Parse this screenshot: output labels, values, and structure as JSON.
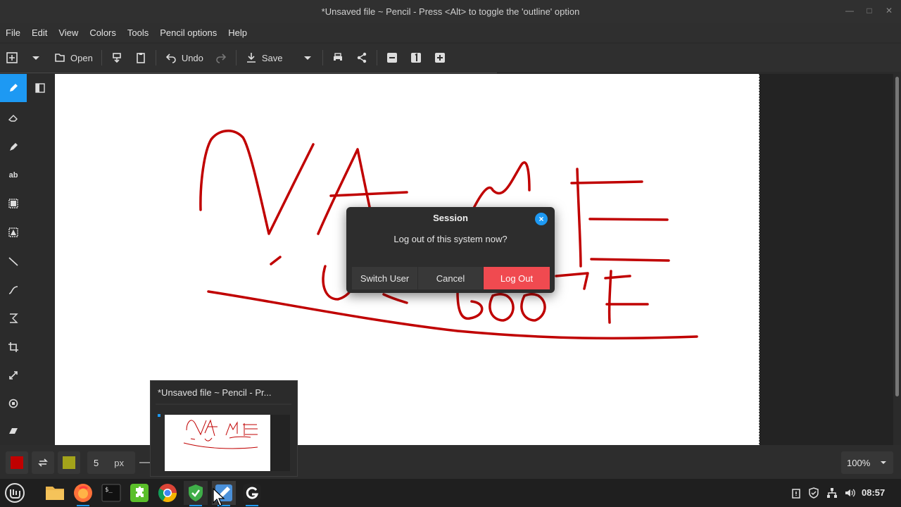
{
  "window": {
    "title": "*Unsaved file ~ Pencil - Press <Alt> to toggle the 'outline' option"
  },
  "menu": [
    "File",
    "Edit",
    "View",
    "Colors",
    "Tools",
    "Pencil options",
    "Help"
  ],
  "toolbar": {
    "open": "Open",
    "undo": "Undo",
    "save": "Save"
  },
  "options": {
    "size_value": "5",
    "size_unit": "px",
    "zoom": "100%"
  },
  "colors": {
    "main": "#c00000",
    "secondary": "#a3a31a",
    "accent": "#1d99f3",
    "danger": "#f04a50",
    "ink": "#c00000"
  },
  "dialog": {
    "title": "Session",
    "message": "Log out of this system now?",
    "switch_user": "Switch User",
    "cancel": "Cancel",
    "log_out": "Log Out"
  },
  "preview": {
    "title": "*Unsaved file ~ Pencil - Pr..."
  },
  "taskbar": {
    "apps": [
      "mint-menu-icon",
      "files-icon",
      "firefox-icon",
      "terminal-icon",
      "puzzle-icon",
      "chrome-icon",
      "shield-icon",
      "pencil-app-icon",
      "g-app-icon"
    ],
    "clock": "08:57"
  }
}
